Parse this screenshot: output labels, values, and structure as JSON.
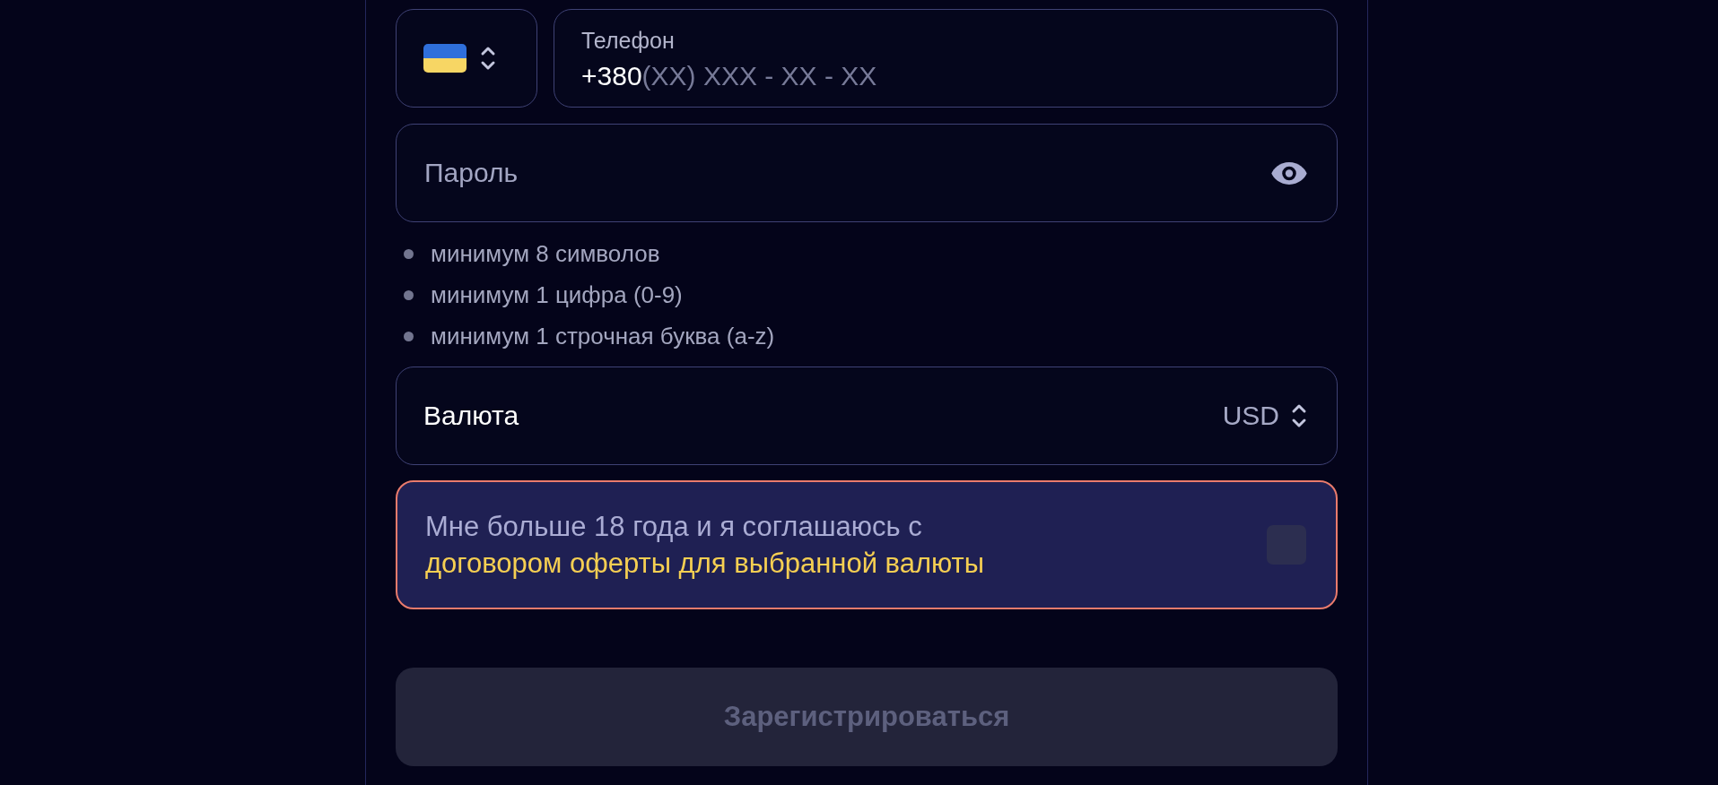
{
  "phone_field": {
    "label": "Телефон",
    "prefix": "+380",
    "placeholder": "(XX) XXX - XX - XX"
  },
  "password_field": {
    "placeholder": "Пароль"
  },
  "password_rules": [
    "минимум 8 символов",
    "минимум 1 цифра (0-9)",
    "минимум 1 строчная буква (a-z)"
  ],
  "currency": {
    "label": "Валюта",
    "value": "USD"
  },
  "agreement": {
    "text": "Мне больше 18 года и я соглашаюсь с",
    "link": "договором оферты для выбранной валюты",
    "checked": false,
    "error": true
  },
  "submit_button": {
    "label": "Зарегистрироваться",
    "disabled": true
  }
}
